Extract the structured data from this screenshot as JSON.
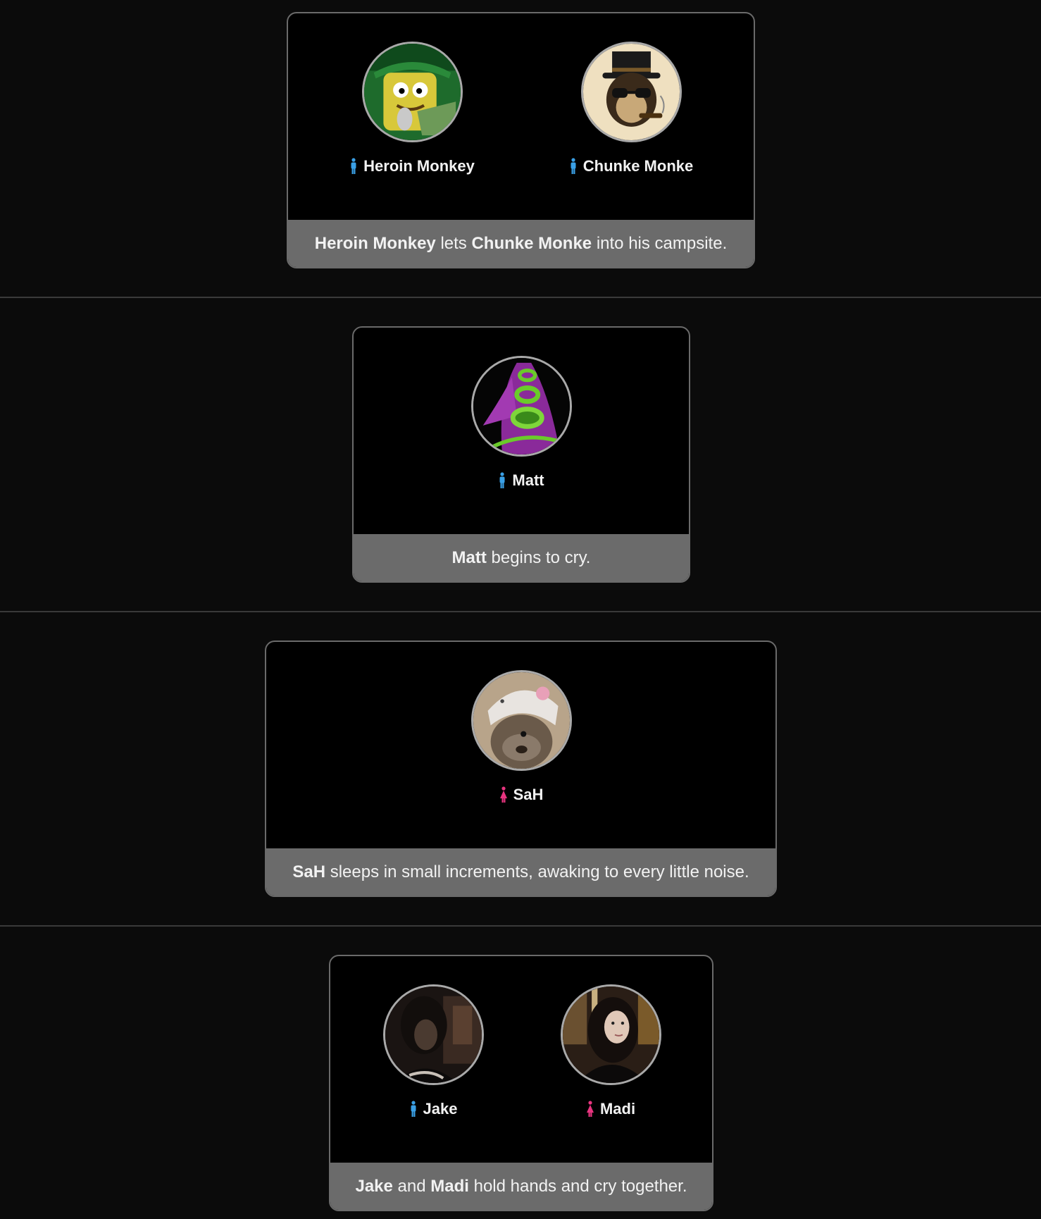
{
  "colors": {
    "male_icon": "#3aa0e6",
    "female_icon": "#e8347f",
    "caption_bg": "#6b6b6b",
    "card_bg": "#000000",
    "page_bg": "#0b0b0b"
  },
  "events": [
    {
      "people": [
        {
          "name": "Heroin Monkey",
          "gender": "male",
          "icon": "male-icon",
          "avatar": "cartoon-sponge-avatar"
        },
        {
          "name": "Chunke Monke",
          "gender": "male",
          "icon": "male-icon",
          "avatar": "top-hat-monkey-avatar"
        }
      ],
      "caption": {
        "parts": [
          {
            "text": "Heroin Monkey",
            "bold": true
          },
          {
            "text": " lets ",
            "bold": false
          },
          {
            "text": "Chunke Monke",
            "bold": true
          },
          {
            "text": " into his campsite.",
            "bold": false
          }
        ]
      }
    },
    {
      "people": [
        {
          "name": "Matt",
          "gender": "male",
          "icon": "male-icon",
          "avatar": "purple-tentacle-avatar"
        }
      ],
      "caption": {
        "parts": [
          {
            "text": "Matt",
            "bold": true
          },
          {
            "text": " begins to cry.",
            "bold": false
          }
        ]
      }
    },
    {
      "people": [
        {
          "name": "SaH",
          "gender": "female",
          "icon": "female-icon",
          "avatar": "otter-hat-avatar"
        }
      ],
      "caption": {
        "parts": [
          {
            "text": "SaH",
            "bold": true
          },
          {
            "text": " sleeps in small increments, awaking to every little noise.",
            "bold": false
          }
        ]
      }
    },
    {
      "people": [
        {
          "name": "Jake",
          "gender": "male",
          "icon": "male-icon",
          "avatar": "dark-photo-avatar"
        },
        {
          "name": "Madi",
          "gender": "female",
          "icon": "female-icon",
          "avatar": "woman-photo-avatar"
        }
      ],
      "caption": {
        "parts": [
          {
            "text": "Jake",
            "bold": true
          },
          {
            "text": " and ",
            "bold": false
          },
          {
            "text": "Madi",
            "bold": true
          },
          {
            "text": " hold hands and cry together.",
            "bold": false
          }
        ]
      }
    }
  ]
}
